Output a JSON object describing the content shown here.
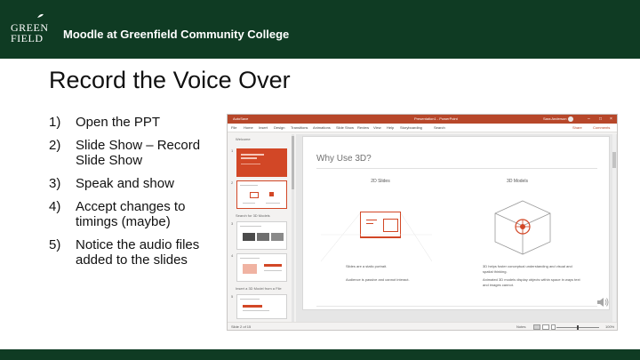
{
  "header": {
    "logo_line1": "GREEN",
    "logo_line2": "FIELD",
    "title": "Moodle at Greenfield Community College"
  },
  "slide": {
    "title": "Record the Voice Over",
    "steps": [
      {
        "num": "1)",
        "text": "Open the PPT"
      },
      {
        "num": "2)",
        "text": "Slide Show – Record Slide Show"
      },
      {
        "num": "3)",
        "text": "Speak and show"
      },
      {
        "num": "4)",
        "text": "Accept changes to timings (maybe)"
      },
      {
        "num": "5)",
        "text": "Notice the audio files added to the slides"
      }
    ]
  },
  "ppt_window": {
    "titlebar": {
      "quick_access": "AutoSave",
      "file_name": "Presentation1 - PowerPoint",
      "user": "Sara Anderson"
    },
    "menu": [
      "File",
      "Home",
      "Insert",
      "Design",
      "Transitions",
      "Animations",
      "Slide Show",
      "Review",
      "View",
      "Help",
      "Storyboarding",
      "Search"
    ],
    "share": "Share",
    "comments": "Comments",
    "thumbnail_sections": [
      "Welcome",
      "Search for 3D Models",
      "Insert a 3D Model from a File"
    ],
    "thumbnail_numbers": [
      "1",
      "2",
      "3",
      "4",
      "5"
    ],
    "current_slide": {
      "title": "Why Use 3D?",
      "col1_heading": "2D Slides",
      "col2_heading": "3D Models",
      "col1_text1": "Slides are a static portrait.",
      "col1_text2": "Audience is passive and cannot interact.",
      "col2_text1": "3D helps foster conceptual understanding and visual and spatial thinking.",
      "col2_text2": "Animated 3D models display objects within space in ways text and images cannot."
    },
    "status": {
      "slide_label": "Slide 2 of 15",
      "notes": "Notes",
      "zoom": "100%"
    }
  },
  "colors": {
    "header_green": "#0f3b23",
    "ppt_accent": "#d24726"
  },
  "icons": [
    "logo-leaf-icon",
    "speaker-icon",
    "cube-3d-icon"
  ]
}
